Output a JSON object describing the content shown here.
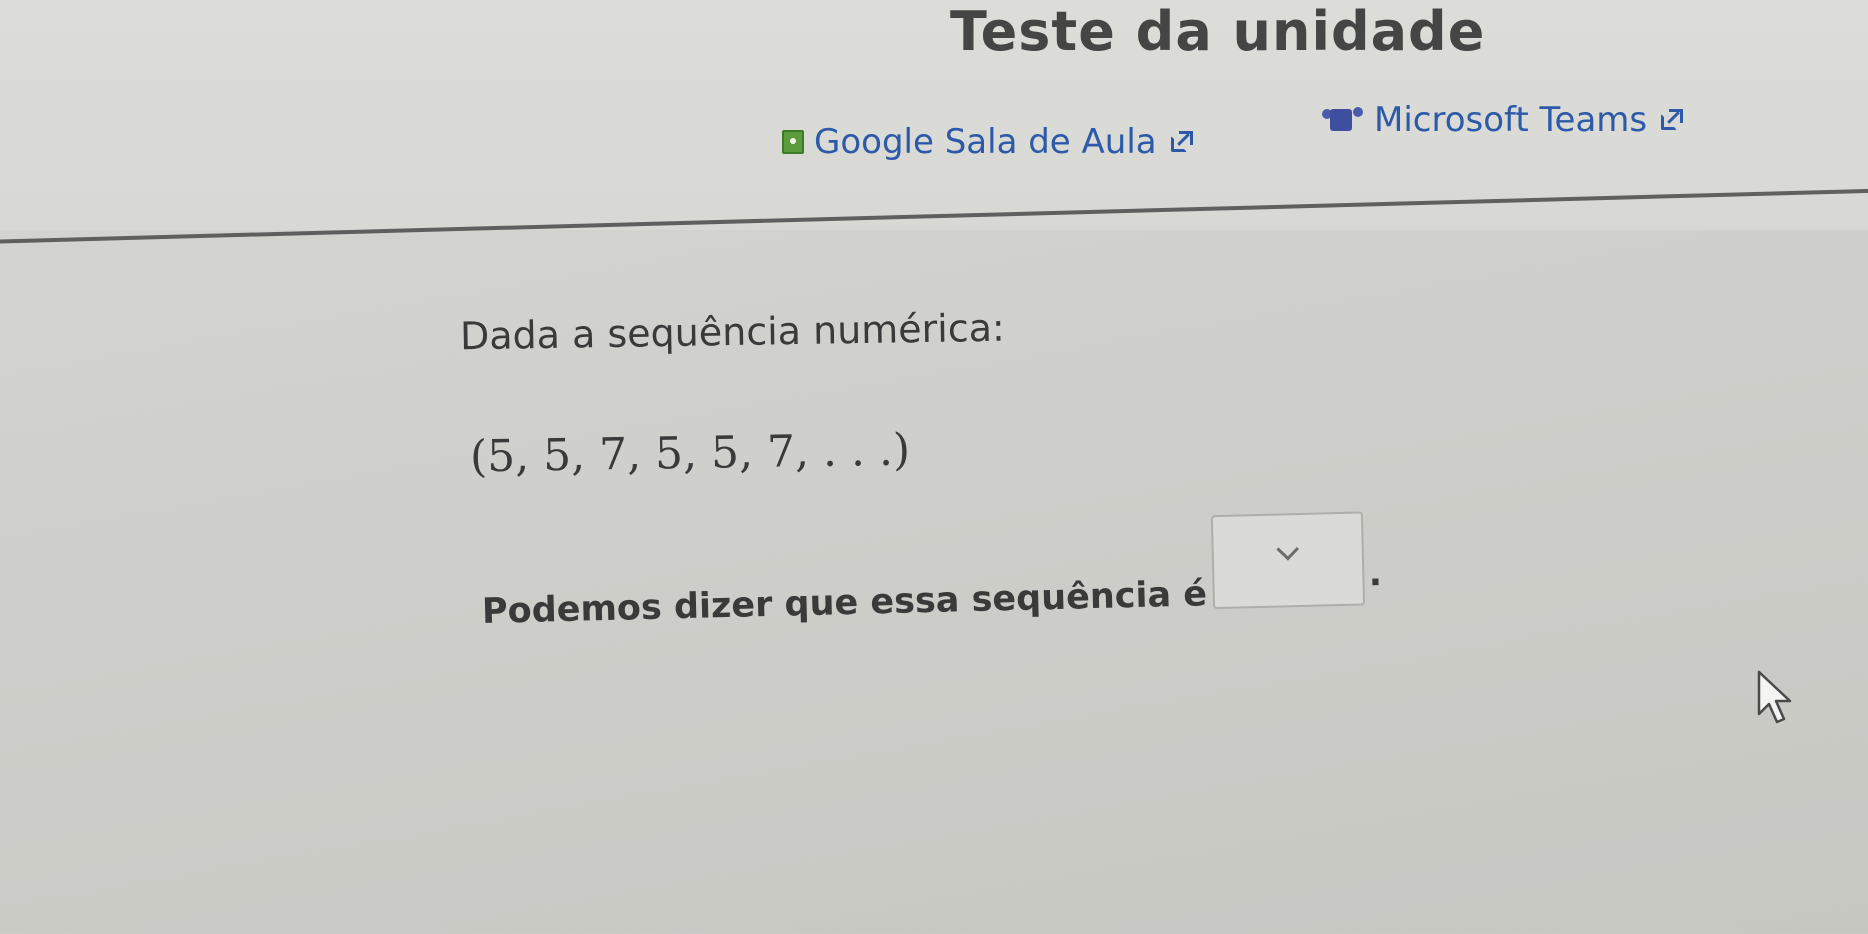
{
  "header": {
    "title": "Teste da unidade",
    "share_links": {
      "google": {
        "label": "Google Sala de Aula",
        "icon": "google-classroom-icon"
      },
      "teams": {
        "label": "Microsoft Teams",
        "icon": "microsoft-teams-icon"
      }
    },
    "link_color": "#2c5aa8"
  },
  "question": {
    "intro": "Dada a sequência numérica:",
    "sequence": "(5, 5, 7, 5, 5, 7, . . .)",
    "prompt": "Podemos dizer que essa sequência é",
    "dropdown_value": "",
    "dropdown_icon": "chevron-down-icon",
    "trailing_punctuation": "."
  }
}
